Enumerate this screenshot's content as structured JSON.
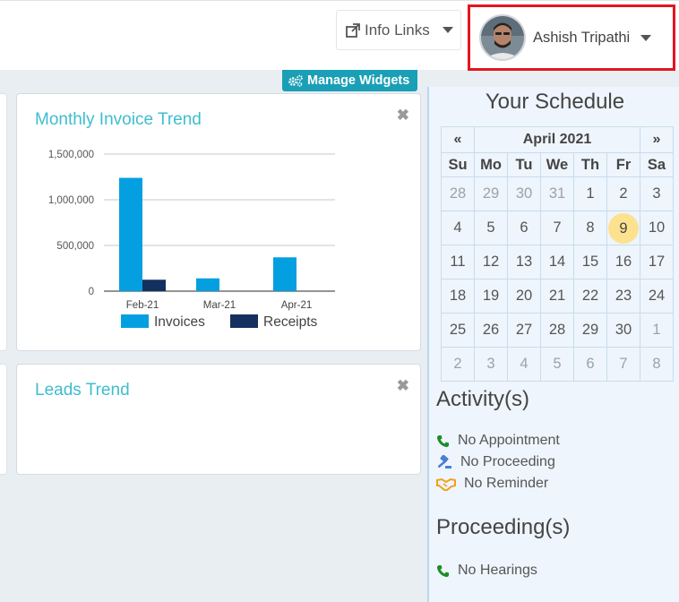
{
  "header": {
    "info_links_label": "Info Links",
    "user_name": "Ashish Tripathi"
  },
  "widgets": {
    "manage_label": "Manage Widgets",
    "monthly_invoice": {
      "title": "Monthly Invoice Trend",
      "close": "✖"
    },
    "leads": {
      "title": "Leads Trend",
      "close": "✖"
    }
  },
  "chart_data": {
    "type": "bar",
    "title": "",
    "categories": [
      "Feb-21",
      "Mar-21",
      "Apr-21"
    ],
    "series": [
      {
        "name": "Invoices",
        "values": [
          1240000,
          140000,
          370000
        ],
        "color": "#049fe0"
      },
      {
        "name": "Receipts",
        "values": [
          125000,
          0,
          0
        ],
        "color": "#14305e"
      }
    ],
    "y_ticks": [
      "0",
      "500,000",
      "1,000,000",
      "1,500,000"
    ],
    "ylim": [
      0,
      1500000
    ],
    "grid": true,
    "legend_position": "bottom"
  },
  "schedule": {
    "title": "Your Schedule",
    "prev": "«",
    "next": "»",
    "month_label": "April 2021",
    "dow": [
      "Su",
      "Mo",
      "Tu",
      "We",
      "Th",
      "Fr",
      "Sa"
    ],
    "weeks": [
      [
        {
          "d": "28",
          "o": true
        },
        {
          "d": "29",
          "o": true
        },
        {
          "d": "30",
          "o": true
        },
        {
          "d": "31",
          "o": true
        },
        {
          "d": "1"
        },
        {
          "d": "2"
        },
        {
          "d": "3"
        }
      ],
      [
        {
          "d": "4"
        },
        {
          "d": "5"
        },
        {
          "d": "6"
        },
        {
          "d": "7"
        },
        {
          "d": "8"
        },
        {
          "d": "9",
          "t": true
        },
        {
          "d": "10"
        }
      ],
      [
        {
          "d": "11"
        },
        {
          "d": "12"
        },
        {
          "d": "13"
        },
        {
          "d": "14"
        },
        {
          "d": "15"
        },
        {
          "d": "16"
        },
        {
          "d": "17"
        }
      ],
      [
        {
          "d": "18"
        },
        {
          "d": "19"
        },
        {
          "d": "20"
        },
        {
          "d": "21"
        },
        {
          "d": "22"
        },
        {
          "d": "23"
        },
        {
          "d": "24"
        }
      ],
      [
        {
          "d": "25"
        },
        {
          "d": "26"
        },
        {
          "d": "27"
        },
        {
          "d": "28"
        },
        {
          "d": "29"
        },
        {
          "d": "30"
        },
        {
          "d": "1",
          "o": true
        }
      ],
      [
        {
          "d": "2",
          "o": true
        },
        {
          "d": "3",
          "o": true
        },
        {
          "d": "4",
          "o": true
        },
        {
          "d": "5",
          "o": true
        },
        {
          "d": "6",
          "o": true
        },
        {
          "d": "7",
          "o": true
        },
        {
          "d": "8",
          "o": true
        }
      ]
    ]
  },
  "activities": {
    "title": "Activity(s)",
    "items": [
      {
        "label": "No Appointment",
        "icon": "phone-icon",
        "color": "#1e8c2a"
      },
      {
        "label": "No Proceeding",
        "icon": "gavel-icon",
        "color": "#4a7fd6"
      },
      {
        "label": "No Reminder",
        "icon": "handshake-icon",
        "color": "#f0a020"
      }
    ]
  },
  "proceedings": {
    "title": "Proceeding(s)",
    "items": [
      {
        "label": "No Hearings",
        "icon": "phone-icon",
        "color": "#1e8c2a"
      }
    ]
  }
}
